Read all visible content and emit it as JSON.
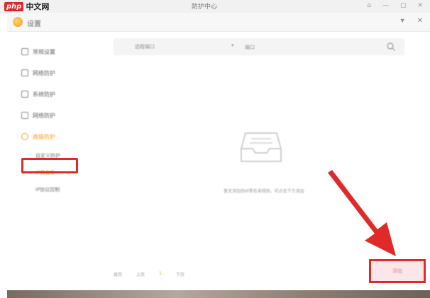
{
  "topbar": {
    "watermark_php": "php",
    "watermark_cn": "中文网",
    "app_title": "防护中心",
    "controls": [
      "⌂",
      "—",
      "▢",
      "✕"
    ]
  },
  "dialog": {
    "title": "设置",
    "controls": [
      "▾",
      "✕"
    ]
  },
  "sidebar": {
    "items": [
      {
        "label": "常规设置"
      },
      {
        "label": "网络防护"
      },
      {
        "label": "系统防护"
      },
      {
        "label": "网络防护"
      },
      {
        "label": "高级防护"
      }
    ],
    "sub_items": [
      {
        "label": "自定义防护"
      },
      {
        "label": "IP黑名单"
      },
      {
        "label": "IP协议控制"
      }
    ]
  },
  "filter": {
    "select_value": "远程端口",
    "search_placeholder": "端口"
  },
  "empty_state": {
    "message": "暂无添加的IP黑名单规则，可点击下方添加"
  },
  "footer": {
    "pager": [
      "首页",
      "上页",
      "1",
      "下页"
    ]
  },
  "actions": {
    "add_label": "添加"
  },
  "colors": {
    "accent": "#f59a18",
    "annotation_red": "#e02a2a"
  }
}
